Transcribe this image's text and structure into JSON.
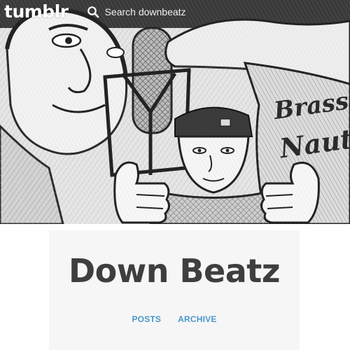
{
  "topbar": {
    "logo_text": "tumblr",
    "search_placeholder": "Search downbeatz"
  },
  "blog": {
    "title": "Down Beatz",
    "nav": [
      {
        "label": "POSTS"
      },
      {
        "label": "ARCHIVE"
      }
    ]
  },
  "header_image": {
    "description_icon": "header-photo",
    "shirt_text": "Brass Nauts"
  },
  "colors": {
    "logo": "#ffffff",
    "title": "#3e3e3e",
    "nav_link": "#4a97c9",
    "card_bg": "#f6f6f6"
  }
}
